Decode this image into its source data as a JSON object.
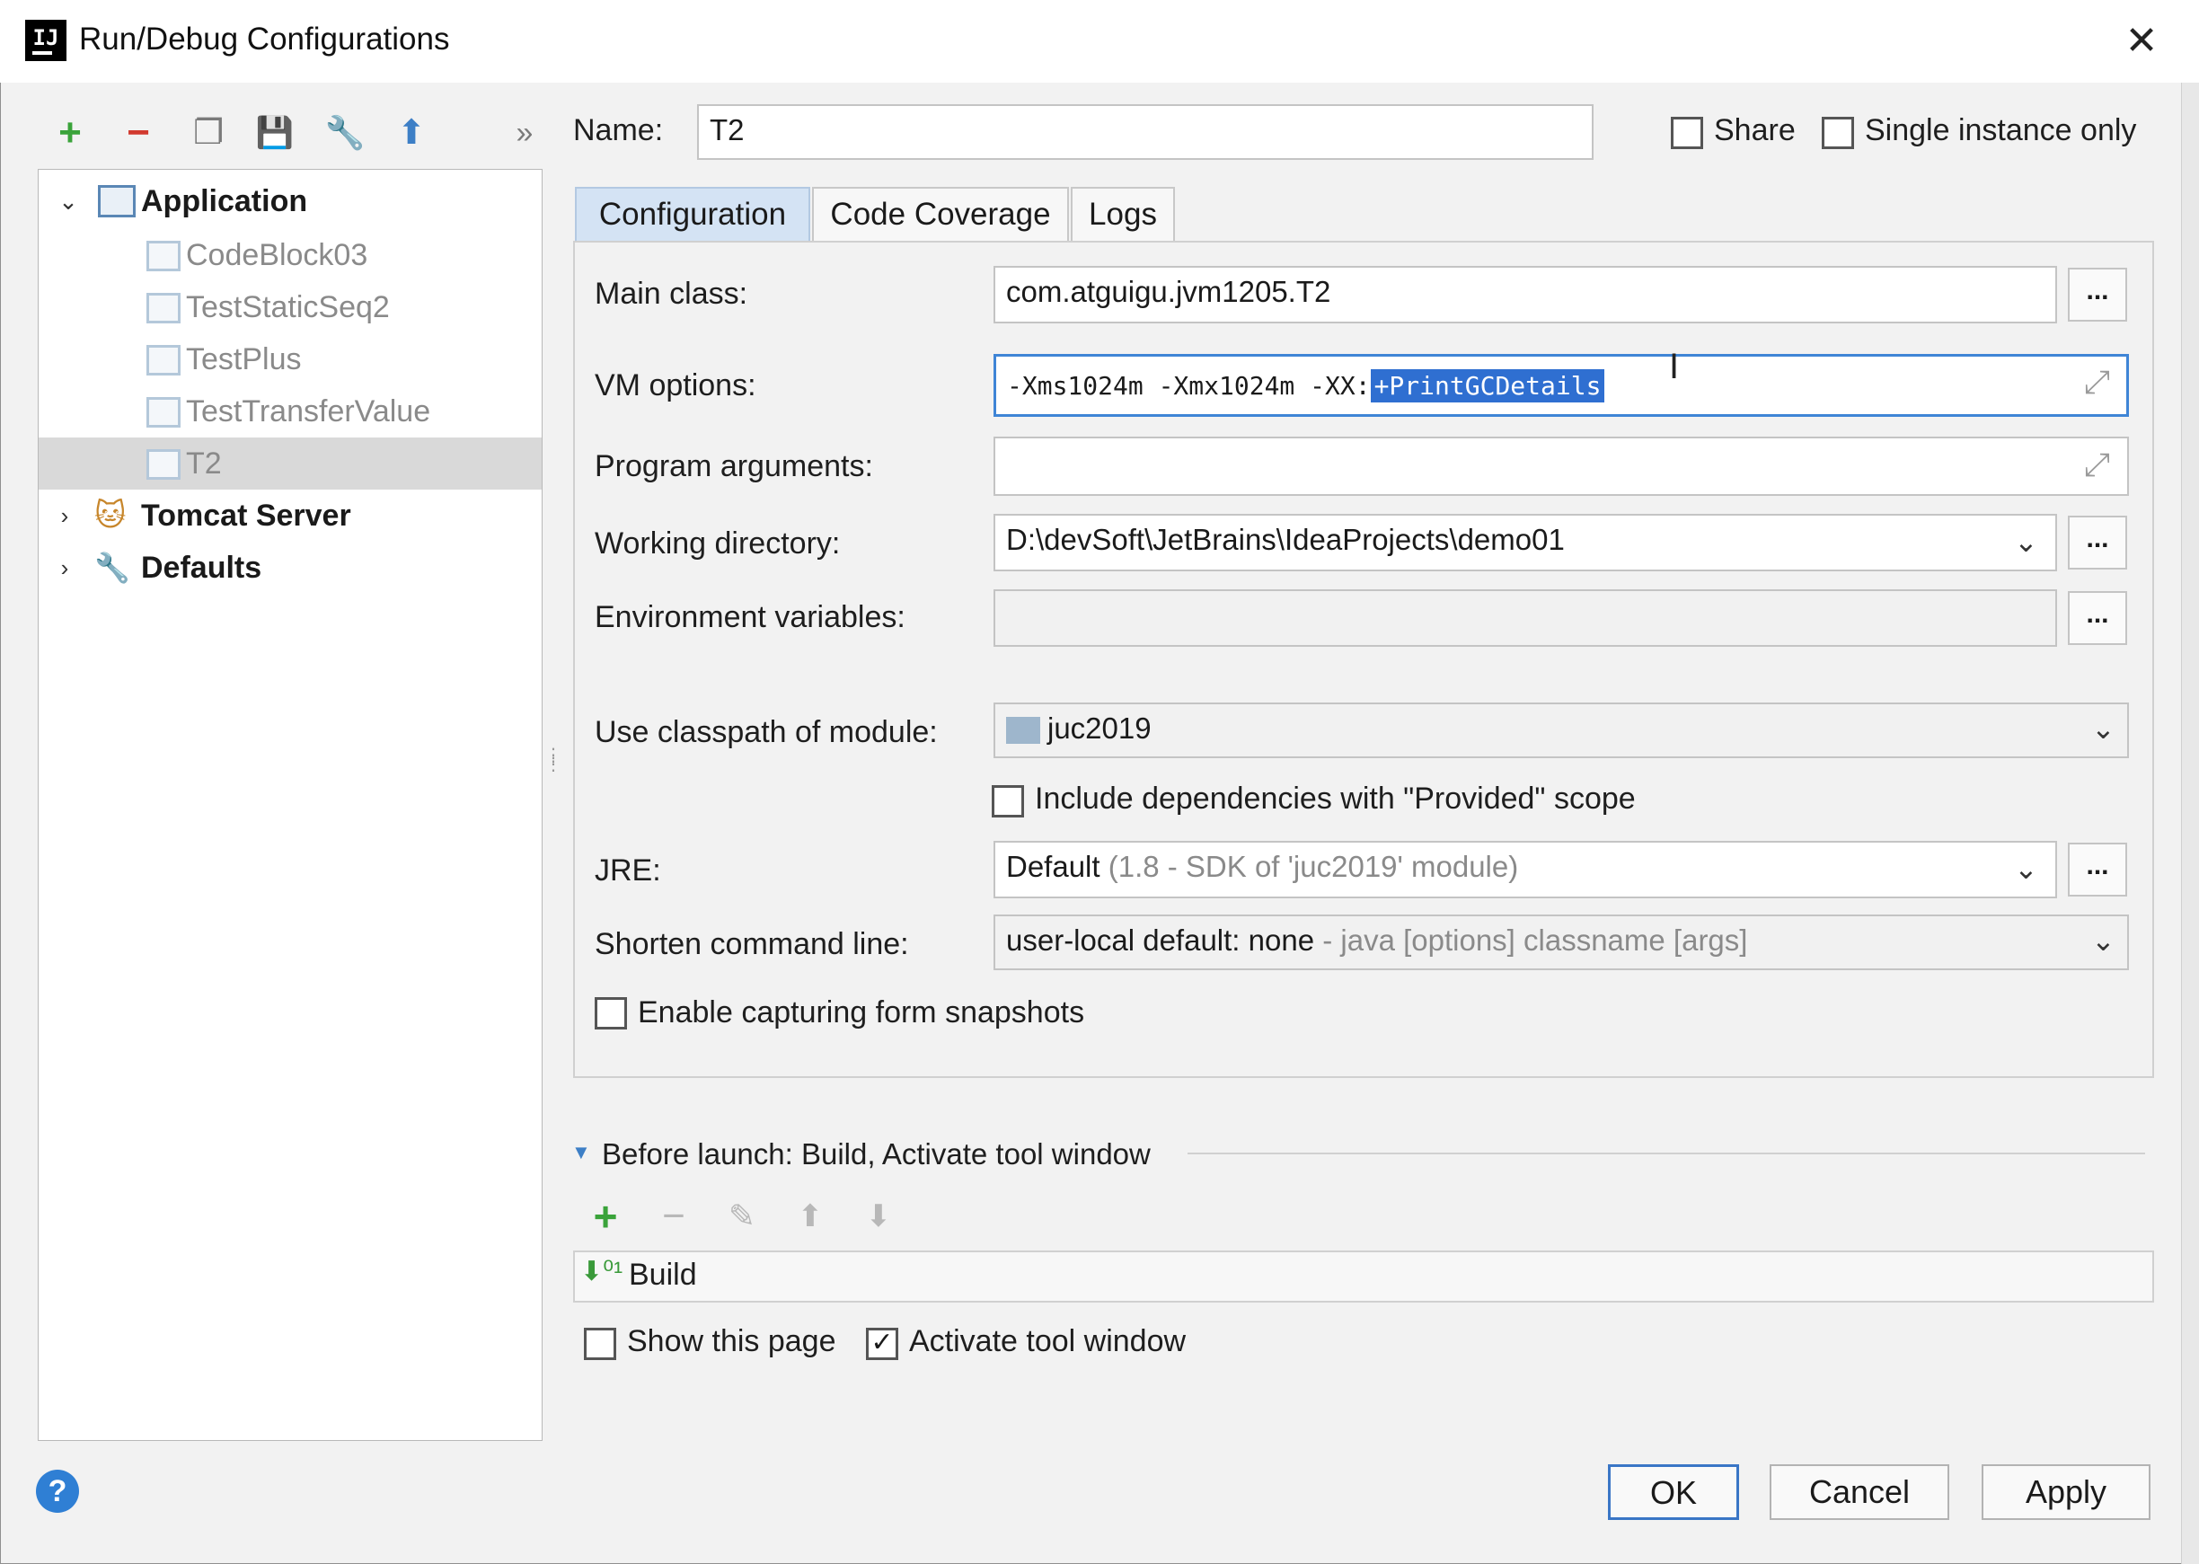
{
  "window": {
    "title": "Run/Debug Configurations",
    "logo": "IJ",
    "close_glyph": "✕"
  },
  "toolbar": {
    "items": [
      {
        "icon": "add-icon",
        "glyph": "+"
      },
      {
        "icon": "remove-icon",
        "glyph": "−"
      },
      {
        "icon": "copy-icon",
        "glyph": "❐"
      },
      {
        "icon": "save-icon",
        "glyph": "💾"
      },
      {
        "icon": "wrench-icon",
        "glyph": "🔧"
      },
      {
        "icon": "move-up-icon",
        "glyph": "⬆"
      },
      {
        "icon": "more-icon",
        "glyph": "»"
      }
    ]
  },
  "tree": {
    "groups": [
      {
        "label": "Application",
        "expanded": true,
        "arrow": "⌄",
        "children": [
          "CodeBlock03",
          "TestStaticSeq2",
          "TestPlus",
          "TestTransferValue",
          "T2"
        ],
        "selected": "T2"
      },
      {
        "label": "Tomcat Server",
        "expanded": false,
        "arrow": "›",
        "icon": "tomcat-icon"
      },
      {
        "label": "Defaults",
        "expanded": false,
        "arrow": "›",
        "icon": "defaults-wrench-icon"
      }
    ]
  },
  "name_field": {
    "label": "Name:",
    "value": "T2"
  },
  "share": {
    "label": "Share",
    "checked": false
  },
  "single_instance": {
    "label": "Single instance only",
    "checked": false
  },
  "tabs": [
    "Configuration",
    "Code Coverage",
    "Logs"
  ],
  "active_tab": "Configuration",
  "form": {
    "main_class": {
      "label": "Main class:",
      "value": "com.atguigu.jvm1205.T2",
      "button": "..."
    },
    "vm_options": {
      "label": "VM options:",
      "value_plain": "-Xms1024m -Xmx1024m -XX:",
      "value_selected": "+PrintGCDetails",
      "expand_glyph": "⤢"
    },
    "program_arguments": {
      "label": "Program arguments:",
      "value": "",
      "expand_glyph": "⤢"
    },
    "working_directory": {
      "label": "Working directory:",
      "value": "D:\\devSoft\\JetBrains\\IdeaProjects\\demo01",
      "button": "..."
    },
    "environment_variables": {
      "label": "Environment variables:",
      "value": "",
      "button": "..."
    },
    "classpath_module": {
      "label": "Use classpath of module:",
      "value": "juc2019"
    },
    "include_provided": {
      "label": "Include dependencies with \"Provided\" scope",
      "checked": false
    },
    "jre": {
      "label": "JRE:",
      "value": "Default",
      "hint": "(1.8 - SDK of 'juc2019' module)",
      "button": "..."
    },
    "shorten_command_line": {
      "label": "Shorten command line:",
      "value": "user-local default: none",
      "hint": "- java [options] classname [args]"
    },
    "capture_snapshots": {
      "label": "Enable capturing form snapshots",
      "checked": false
    }
  },
  "before_launch": {
    "header": "Before launch: Build, Activate tool window",
    "toolbar": [
      {
        "icon": "add-icon",
        "glyph": "+"
      },
      {
        "icon": "remove-icon",
        "glyph": "−"
      },
      {
        "icon": "edit-icon",
        "glyph": "✎"
      },
      {
        "icon": "move-up-icon",
        "glyph": "⬆"
      },
      {
        "icon": "move-down-icon",
        "glyph": "⬇"
      }
    ],
    "tasks": [
      "Build"
    ],
    "show_page": {
      "label": "Show this page",
      "checked": false
    },
    "activate_tool_window": {
      "label": "Activate tool window",
      "checked": true
    }
  },
  "buttons": {
    "ok": "OK",
    "cancel": "Cancel",
    "apply": "Apply",
    "help": "?"
  },
  "colors": {
    "accent": "#3f85d6",
    "selection": "#2f6fd1",
    "add_green": "#3aa33a",
    "remove_red": "#d23a2f"
  }
}
